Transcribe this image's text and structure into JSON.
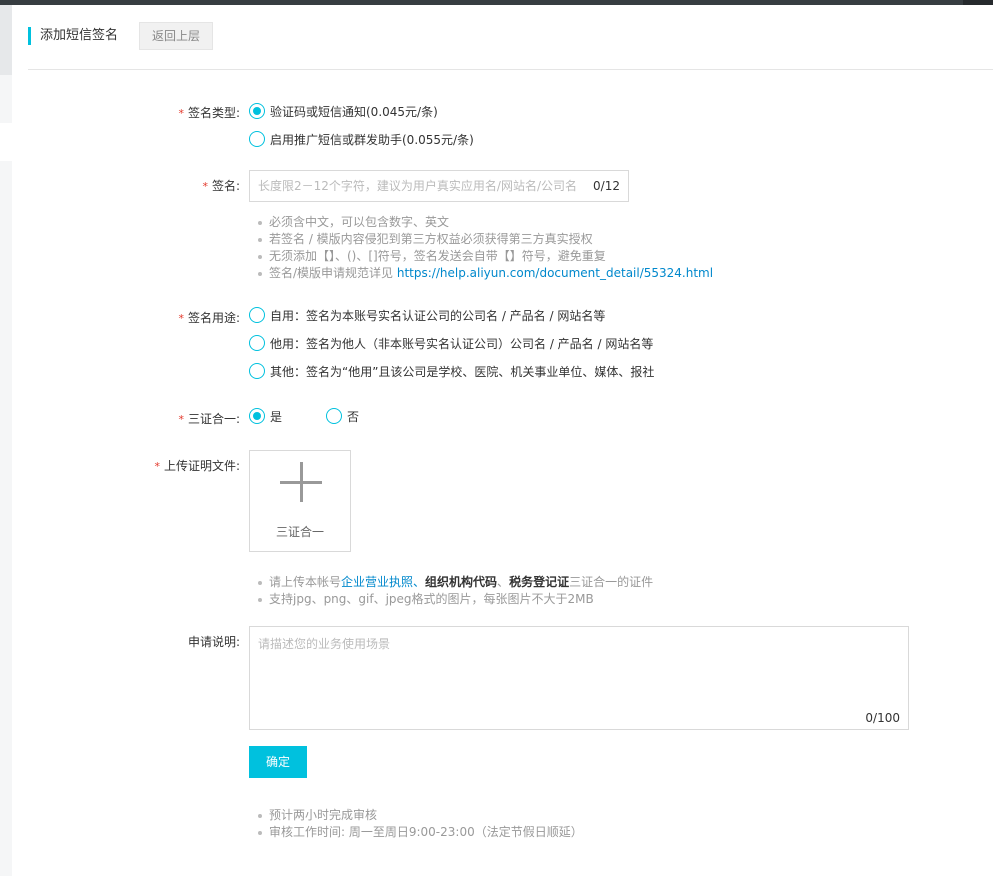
{
  "header": {
    "title": "添加短信签名",
    "back_label": "返回上层"
  },
  "form": {
    "sign_type": {
      "label": "签名类型:",
      "options": [
        {
          "label": "验证码或短信通知(0.045元/条)",
          "checked": true
        },
        {
          "label": "启用推广短信或群发助手(0.055元/条)",
          "checked": false
        }
      ]
    },
    "sign_name": {
      "label": "签名:",
      "placeholder": "长度限2－12个字符，建议为用户真实应用名/网站名/公司名",
      "value": "",
      "counter": "0/12",
      "notes": [
        "必须含中文，可以包含数字、英文",
        "若签名 / 模版内容侵犯到第三方权益必须获得第三方真实授权",
        "无须添加【】、()、[]符号，签名发送会自带【】符号，避免重复"
      ],
      "note_link_prefix": "签名/模版申请规范详见 ",
      "note_link": "https://help.aliyun.com/document_detail/55324.html"
    },
    "sign_usage": {
      "label": "签名用途:",
      "options": [
        {
          "label": "自用：签名为本账号实名认证公司的公司名 / 产品名 / 网站名等",
          "checked": false
        },
        {
          "label": "他用：签名为他人（非本账号实名认证公司）公司名 / 产品名 / 网站名等",
          "checked": false
        },
        {
          "label": "其他：签名为“他用”且该公司是学校、医院、机关事业单位、媒体、报社",
          "checked": false
        }
      ]
    },
    "three_in_one": {
      "label": "三证合一:",
      "options": [
        {
          "label": "是",
          "checked": true
        },
        {
          "label": "否",
          "checked": false
        }
      ]
    },
    "upload": {
      "label": "上传证明文件:",
      "tile_label": "三证合一",
      "note1": {
        "prefix": "请上传本帐号",
        "link": "企业营业执照、",
        "bold1": "组织机构代码",
        "sep": "、",
        "bold2": "税务登记证",
        "suffix": "三证合一的证件"
      },
      "note2": "支持jpg、png、gif、jpeg格式的图片，每张图片不大于2MB"
    },
    "description": {
      "label": "申请说明:",
      "placeholder": "请描述您的业务使用场景",
      "counter": "0/100"
    },
    "submit_label": "确定",
    "footer_notes": [
      "预计两小时完成审核",
      "审核工作时间: 周一至周日9:00-23:00（法定节假日顺延）"
    ]
  }
}
